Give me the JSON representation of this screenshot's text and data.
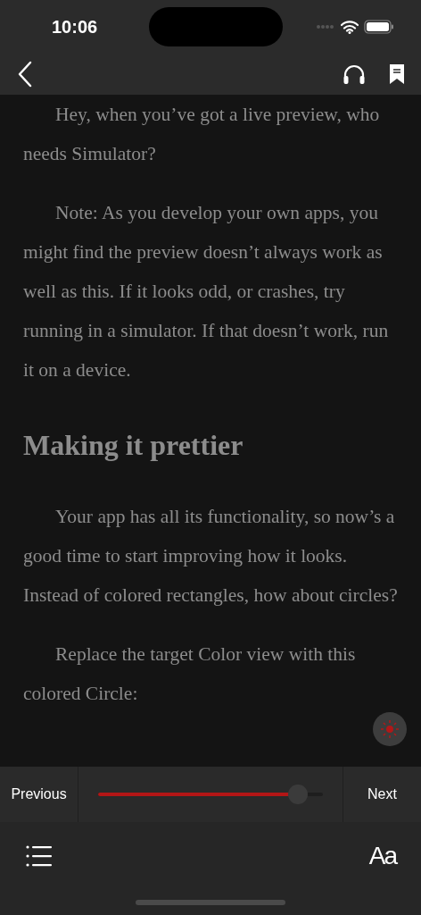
{
  "status_bar": {
    "time": "10:06"
  },
  "content": [
    {
      "kind": "paragraph",
      "text": "Hey, when you’ve got a live preview, who needs Simulator?"
    },
    {
      "kind": "paragraph",
      "text": "Note: As you develop your own apps, you might find the preview doesn’t always work as well as this. If it looks odd, or crashes, try running in a simulator. If that doesn’t work, run it on a device."
    },
    {
      "kind": "heading",
      "text": "Making it prettier"
    },
    {
      "kind": "paragraph",
      "text": "Your app has all its functionality, so now’s a good time to start improving how it looks. Instead of colored rectangles, how about circles?"
    },
    {
      "kind": "paragraph",
      "text": "Replace the target Color view with this colored Circle:"
    }
  ],
  "navigation": {
    "previous": "Previous",
    "next": "Next",
    "progress": {
      "level": 0.89
    }
  },
  "toolbar": {
    "font_button": "Aa"
  }
}
